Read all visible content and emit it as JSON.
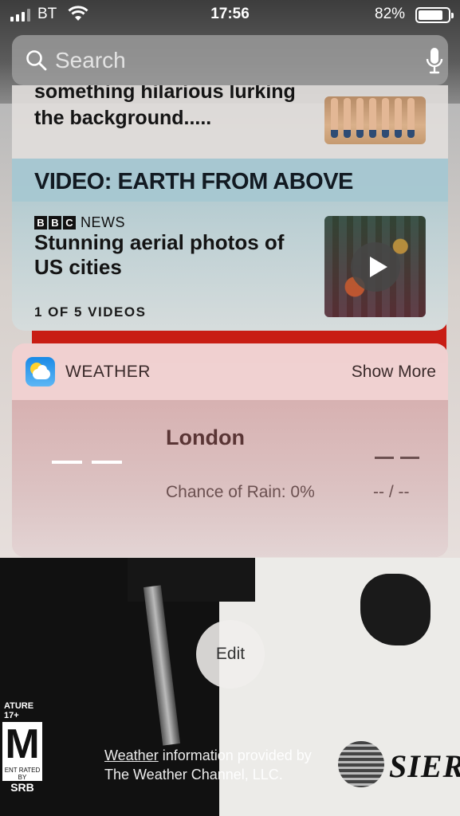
{
  "status_bar": {
    "carrier": "BT",
    "time": "17:56",
    "battery_percent": "82%",
    "battery_level": 0.82,
    "icons": [
      "signal-icon",
      "wifi-icon",
      "battery-icon"
    ]
  },
  "search": {
    "placeholder": "Search",
    "icons": [
      "search-icon",
      "mic-icon"
    ]
  },
  "news_widget": {
    "previous_story_title": "something hilarious lurking the background.....",
    "video_section_title": "VIDEO: EARTH FROM ABOVE",
    "source": {
      "letters": [
        "B",
        "B",
        "C"
      ],
      "label": "NEWS"
    },
    "video_title": "Stunning aerial photos of US cities",
    "video_count": "1 OF 5 VIDEOS"
  },
  "weather_widget": {
    "app_name": "WEATHER",
    "show_more": "Show More",
    "city": "London",
    "rain_chance": "Chance of Rain: 0%",
    "hi_lo": "-- / --"
  },
  "edit_label": "Edit",
  "attribution": {
    "link_text": "Weather",
    "line1_rest": " information provided by",
    "line2": "The Weather Channel, LLC."
  },
  "wallpaper": {
    "rating_top": "ATURE 17+",
    "rating_letter": "M",
    "rating_small": "ENT RATED BY",
    "rating_bottom": "SRB",
    "publisher": "SIER"
  },
  "colors": {
    "news_video_band": "#a6c7d1",
    "weather_tint": "#e6c8c8",
    "wallpaper_red": "#c81d14"
  }
}
